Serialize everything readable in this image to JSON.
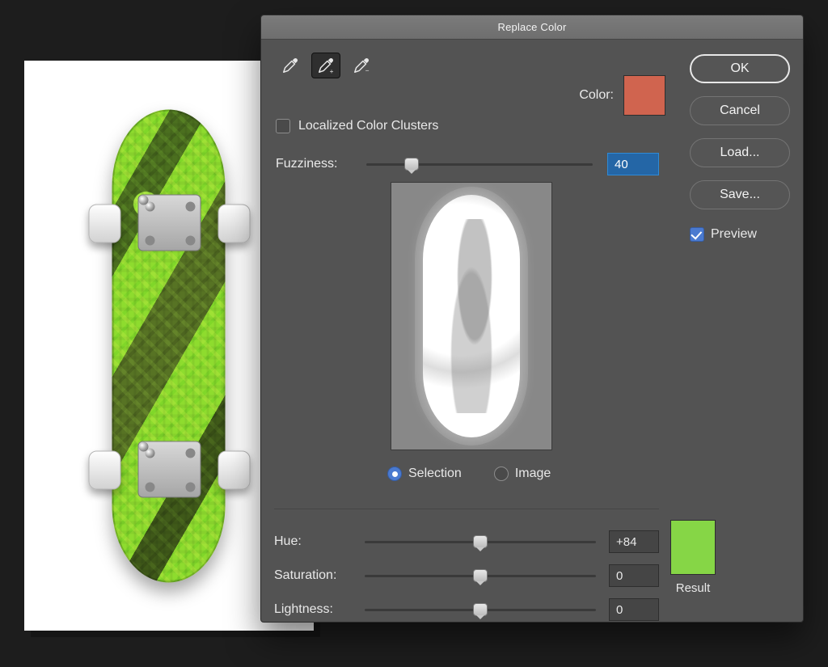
{
  "dialog": {
    "title": "Replace Color",
    "tools": {
      "eyedropper": "eyedropper",
      "eyedropper_add": "eyedropper-add",
      "eyedropper_sub": "eyedropper-subtract",
      "selected": 1
    },
    "color_label": "Color:",
    "color_swatch": "#d0644f",
    "localized_label": "Localized Color Clusters",
    "localized_checked": false,
    "fuzziness_label": "Fuzziness:",
    "fuzziness_value": "40",
    "fuzziness_pct": 20,
    "radio_selection": "Selection",
    "radio_image": "Image",
    "radio_selected": "Selection",
    "hue_label": "Hue:",
    "hue_value": "+84",
    "hue_pct": 50,
    "sat_label": "Saturation:",
    "sat_value": "0",
    "sat_pct": 50,
    "light_label": "Lightness:",
    "light_value": "0",
    "light_pct": 50,
    "result_label": "Result",
    "result_swatch": "#86d646"
  },
  "buttons": {
    "ok": "OK",
    "cancel": "Cancel",
    "load": "Load...",
    "save": "Save..."
  },
  "preview": {
    "label": "Preview",
    "checked": true
  }
}
